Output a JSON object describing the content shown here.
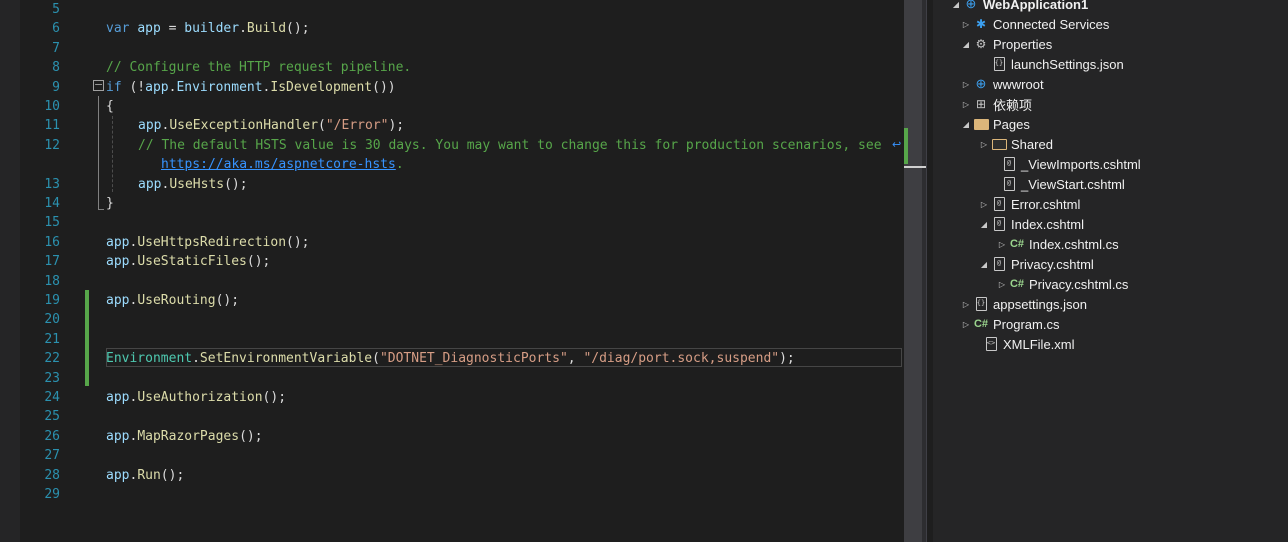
{
  "editor": {
    "lines": [
      {
        "n": "5"
      },
      {
        "n": "6"
      },
      {
        "n": "7"
      },
      {
        "n": "8"
      },
      {
        "n": "9"
      },
      {
        "n": "10"
      },
      {
        "n": "11"
      },
      {
        "n": "12"
      },
      {
        "n": ""
      },
      {
        "n": "13"
      },
      {
        "n": "14"
      },
      {
        "n": "15"
      },
      {
        "n": "16"
      },
      {
        "n": "17"
      },
      {
        "n": "18"
      },
      {
        "n": "19"
      },
      {
        "n": "20"
      },
      {
        "n": "21"
      },
      {
        "n": "22"
      },
      {
        "n": "23"
      },
      {
        "n": "24"
      },
      {
        "n": "25"
      },
      {
        "n": "26"
      },
      {
        "n": "27"
      },
      {
        "n": "28"
      },
      {
        "n": "29"
      }
    ],
    "tokens": {
      "var": "var",
      "app": "app",
      "assign": " = ",
      "builder": "builder",
      "dot": ".",
      "Build": "Build",
      "call_end": "();",
      "comment_configure": "// Configure the HTTP request pipeline.",
      "if": "if",
      "if_open": " (!",
      "Environment": "Environment",
      "IsDevelopment": "IsDevelopment",
      "call_close_paren": "())",
      "brace_open": "{",
      "brace_close": "}",
      "UseExceptionHandler": "UseExceptionHandler",
      "paren_open": "(",
      "error_str": "\"/Error\"",
      "paren_close_semi": ");",
      "comment_hsts": "// The default HSTS value is 30 days. You may want to change this for production scenarios, see",
      "hsts_link": "https://aka.ms/aspnetcore-hsts",
      "period": ".",
      "UseHsts": "UseHsts",
      "UseHttpsRedirection": "UseHttpsRedirection",
      "UseStaticFiles": "UseStaticFiles",
      "UseRouting": "UseRouting",
      "SetEnvironmentVariable": "SetEnvironmentVariable",
      "env_key": "\"DOTNET_DiagnosticPorts\"",
      "comma": ", ",
      "env_val": "\"/diag/port.sock,suspend\"",
      "UseAuthorization": "UseAuthorization",
      "MapRazorPages": "MapRazorPages",
      "Run": "Run"
    },
    "collapse_glyph": "−",
    "wrap_glyph": "↩"
  },
  "solution_explorer": {
    "items": [
      {
        "label": "WebApplication1",
        "icon": "web-project-icon"
      },
      {
        "label": "Connected Services",
        "icon": "connected-services-icon"
      },
      {
        "label": "Properties",
        "icon": "wrench-icon"
      },
      {
        "label": "launchSettings.json",
        "icon": "json-file-icon"
      },
      {
        "label": "wwwroot",
        "icon": "globe-icon"
      },
      {
        "label": "依赖项",
        "icon": "dependencies-icon"
      },
      {
        "label": "Pages",
        "icon": "folder-open-icon"
      },
      {
        "label": "Shared",
        "icon": "folder-icon"
      },
      {
        "label": "_ViewImports.cshtml",
        "icon": "razor-file-icon"
      },
      {
        "label": "_ViewStart.cshtml",
        "icon": "razor-file-icon"
      },
      {
        "label": "Error.cshtml",
        "icon": "razor-file-icon"
      },
      {
        "label": "Index.cshtml",
        "icon": "razor-file-icon"
      },
      {
        "label": "Index.cshtml.cs",
        "icon": "csharp-file-icon"
      },
      {
        "label": "Privacy.cshtml",
        "icon": "razor-file-icon"
      },
      {
        "label": "Privacy.cshtml.cs",
        "icon": "csharp-file-icon"
      },
      {
        "label": "appsettings.json",
        "icon": "json-file-icon"
      },
      {
        "label": "Program.cs",
        "icon": "csharp-file-icon"
      },
      {
        "label": "XMLFile.xml",
        "icon": "xml-file-icon"
      }
    ],
    "glyphs": {
      "expanded": "◢",
      "collapsed": "▷",
      "cs": "C#",
      "json": "{}",
      "xml": "<>",
      "razor": "@",
      "globe": "⊕",
      "web": "⊕",
      "dep": "⊞",
      "svc": "✱",
      "wrench": "⚙"
    }
  },
  "colors": {
    "accent_green": "#57a64a",
    "line_number": "#2b91af",
    "keyword": "#569cd6"
  }
}
